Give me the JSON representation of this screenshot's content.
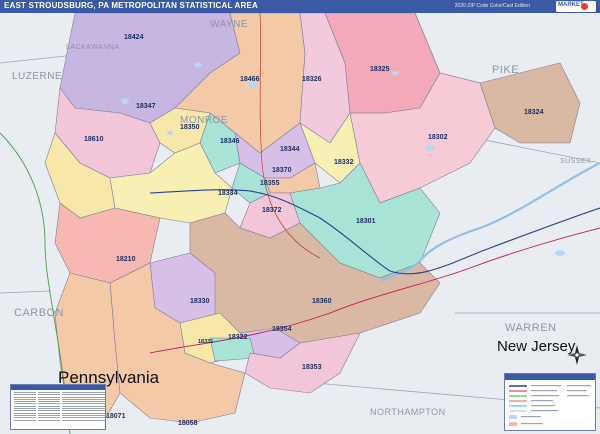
{
  "header": {
    "title": "EAST STROUDSBURG, PA METROPOLITAN STATISTICAL AREA",
    "edition": "2020 ZIP Code Color/Cast Edition"
  },
  "counties": {
    "wayne": "WAYNE",
    "lackawanna": "LACKAWANNA",
    "luzerne": "LUZERNE",
    "pike": "PIKE",
    "monroe": "MONROE",
    "sussex": "SUSSEX",
    "carbon": "CARBON",
    "warren": "WARREN",
    "northampton": "NORTHAMPTON"
  },
  "states": {
    "new_jersey": "New Jersey",
    "pennsylvania": "Pennsylvania"
  },
  "zips": {
    "z18424": "18424",
    "z18466": "18466",
    "z18326": "18326",
    "z18325": "18325",
    "z18324": "18324",
    "z18347": "18347",
    "z18350": "18350",
    "z18610": "18610",
    "z18346": "18346",
    "z18344": "18344",
    "z18302": "18302",
    "z18370": "18370",
    "z18332": "18332",
    "z18355": "18355",
    "z18334": "18334",
    "z18372": "18372",
    "z18301": "18301",
    "z18210": "18210",
    "z18330": "18330",
    "z18360": "18360",
    "z18354": "18354",
    "z18331": "18331",
    "z18322": "18322",
    "z18353": "18353",
    "z18071": "18071",
    "z18058": "18058"
  },
  "colors": {
    "title_bar": "#3b5aa6",
    "background_land": "#e9ecf1",
    "water": "#b9d7f2"
  },
  "icons": {
    "compass": "north-arrow-compass",
    "brand": "market-maps-logo"
  }
}
